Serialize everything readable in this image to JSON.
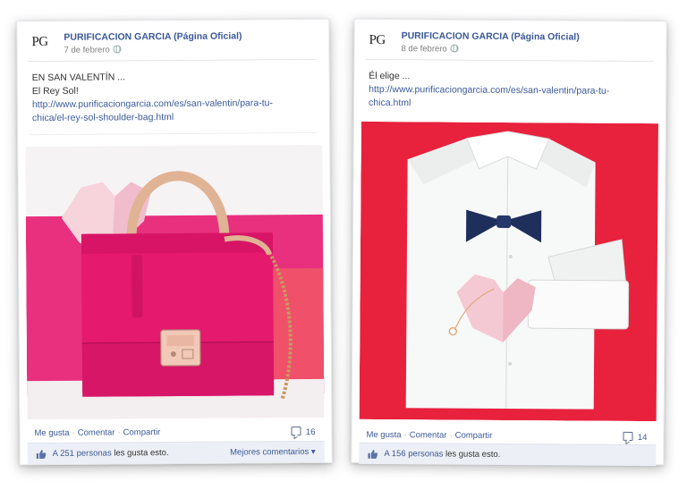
{
  "posts": [
    {
      "logo": "PG",
      "author": "PURIFICACION GARCIA (Página Oficial)",
      "date": "7 de febrero",
      "text_lines": [
        "EN SAN VALENTÍN ...",
        "El Rey Sol!"
      ],
      "link_lines": [
        "http://www.purificaciongarcia.com/es/san-valentin/para-tu-",
        "chica/el-rey-sol-shoulder-bag.html"
      ],
      "image_alt": "pink handbag with origami heart",
      "actions": {
        "like": "Me gusta",
        "comment": "Comentar",
        "share": "Compartir",
        "separator": "·"
      },
      "comment_count": "16",
      "likes_people": "A 251 personas",
      "likes_suffix": "les gusta esto.",
      "best_comments": "Mejores comentarios ▾"
    },
    {
      "logo": "PG",
      "author": "PURIFICACION GARCIA (Página Oficial)",
      "date": "8 de febrero",
      "text_lines": [
        "Él elige ..."
      ],
      "link_lines": [
        "http://www.purificaciongarcia.com/es/san-valentin/para-tu-",
        "chica.html"
      ],
      "image_alt": "white shirt with navy bow tie and origami heart on red",
      "actions": {
        "like": "Me gusta",
        "comment": "Comentar",
        "share": "Compartir",
        "separator": "·"
      },
      "comment_count": "14",
      "likes_people": "A 156 personas",
      "likes_suffix": "les gusta esto."
    }
  ],
  "colors": {
    "link": "#3b5998",
    "bag_pink": "#e8337a",
    "bg_magenta": "#e8307f",
    "bg_coral": "#f0506a",
    "shirt_red": "#e8213d",
    "bowtie_navy": "#1f2f5c",
    "heart_pink": "#f5c9d3"
  }
}
